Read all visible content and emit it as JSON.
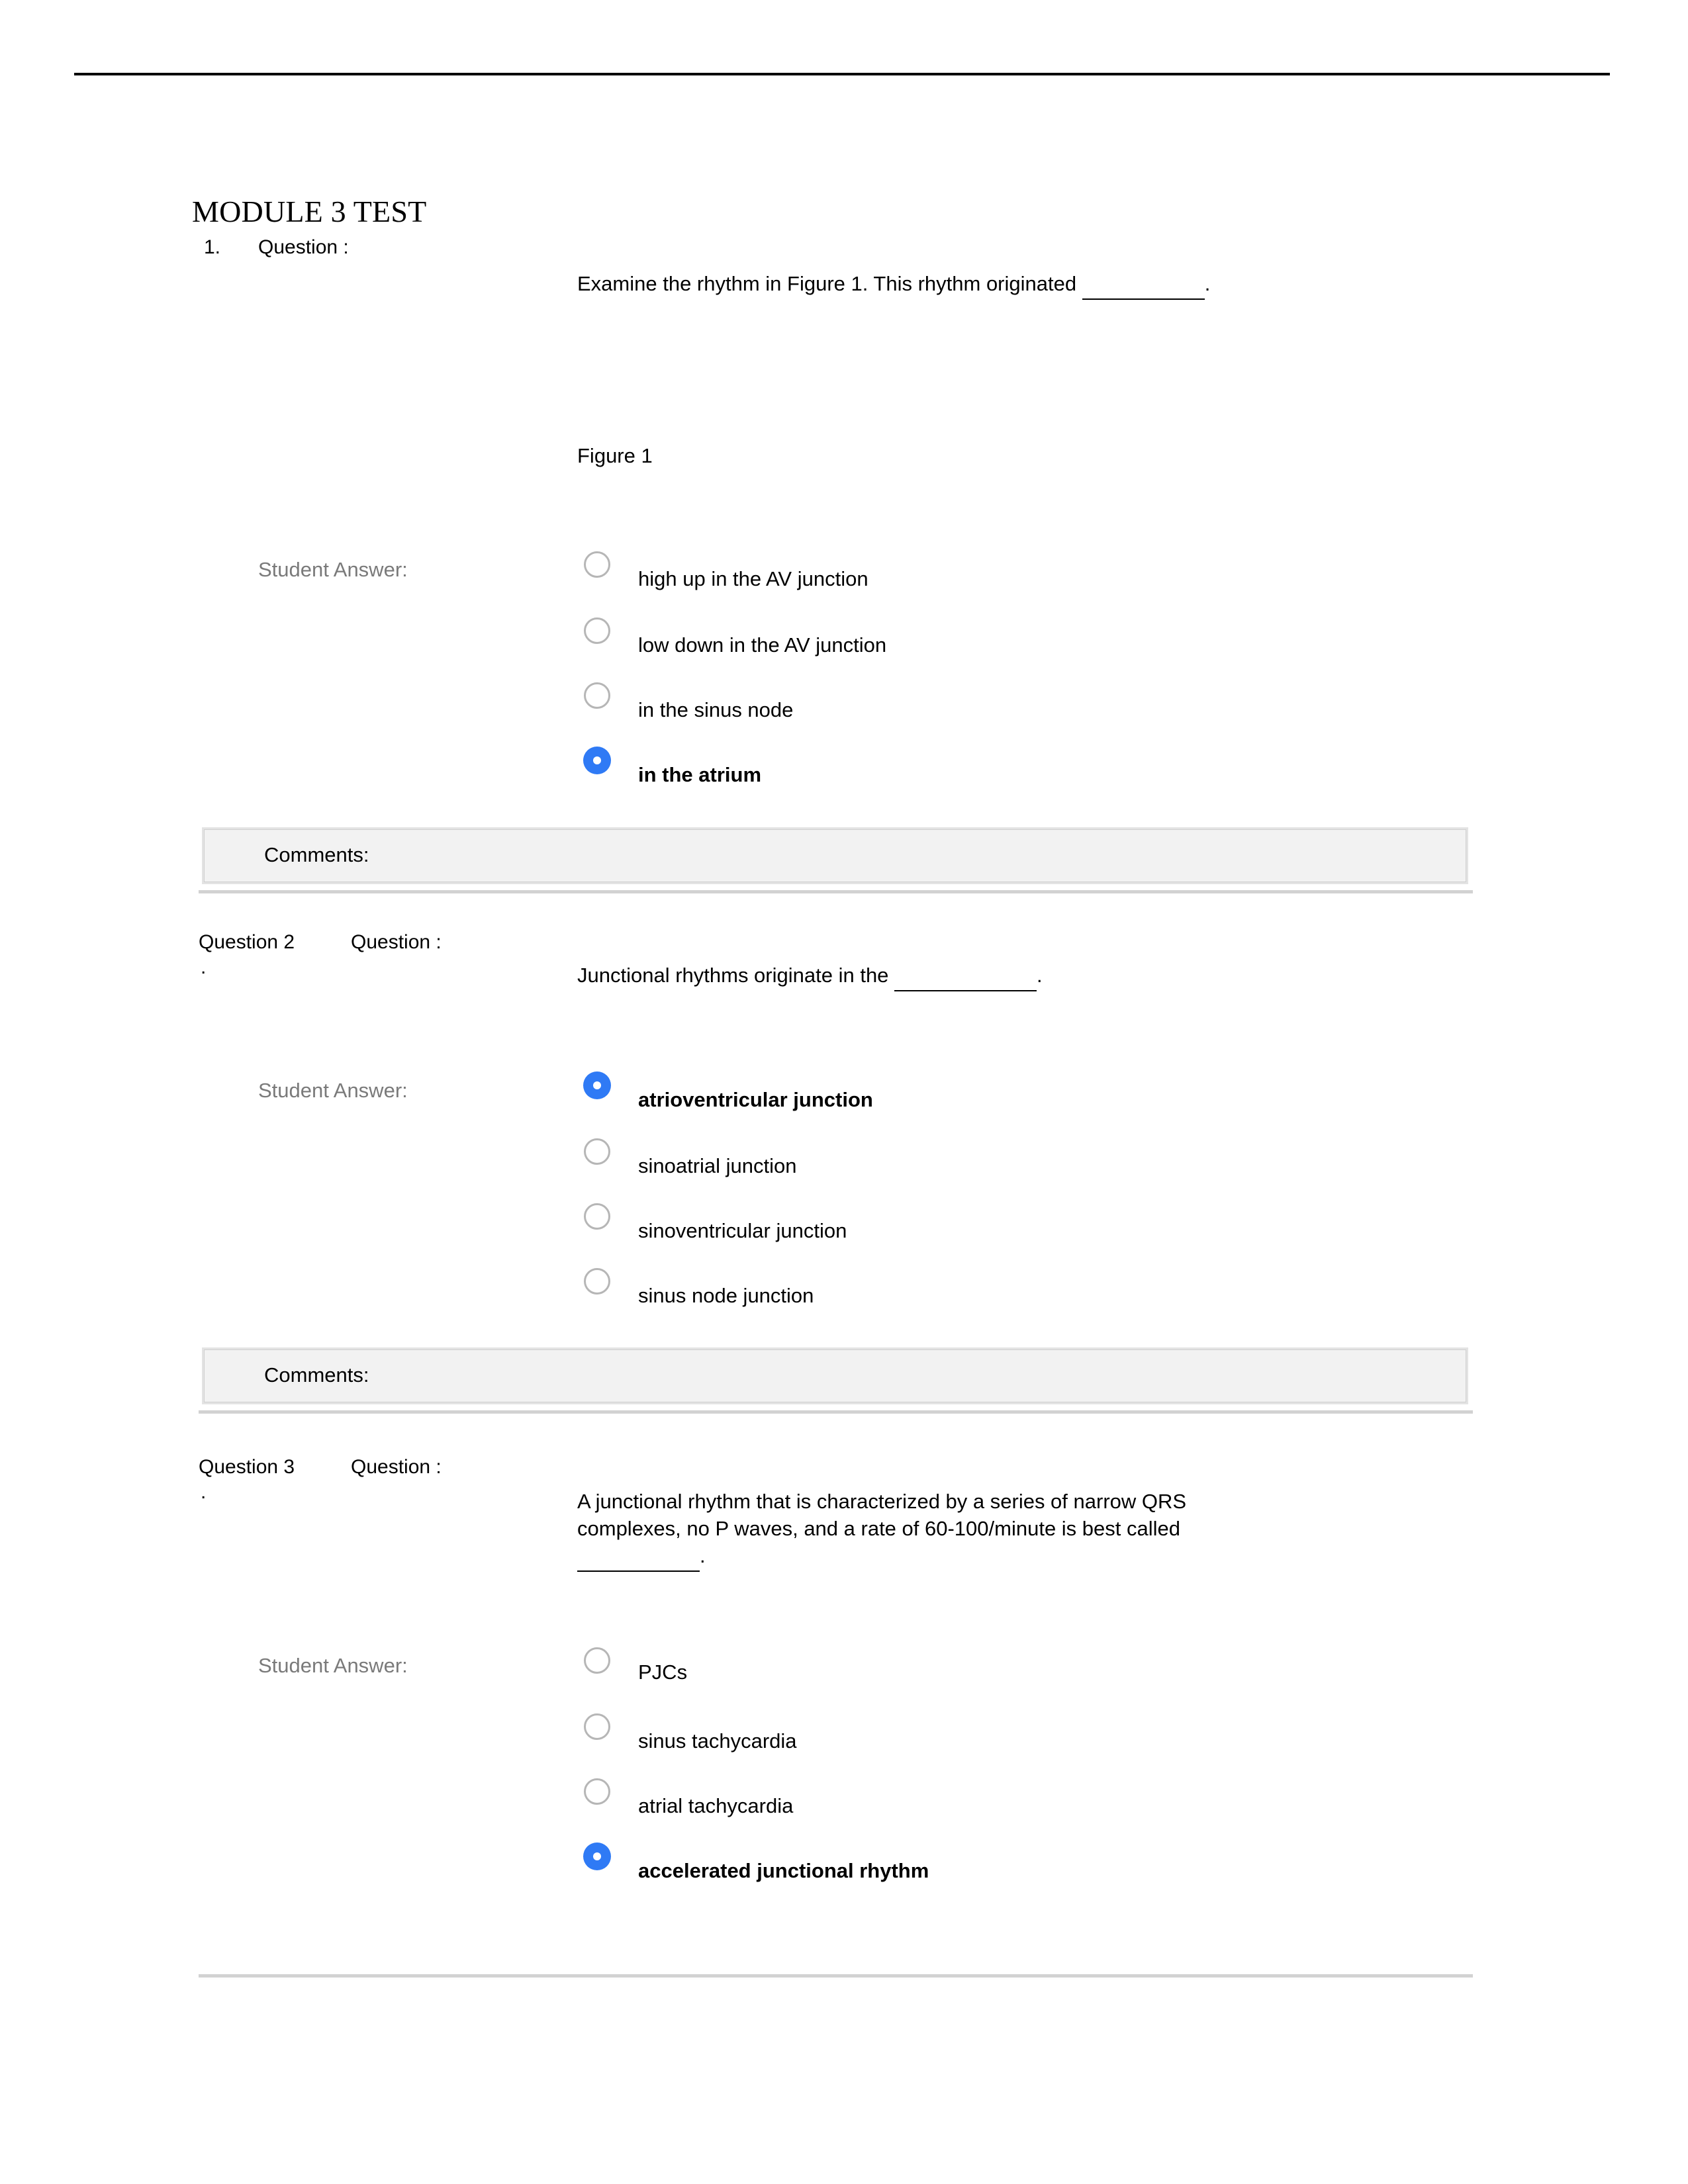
{
  "document": {
    "title": "MODULE 3 TEST"
  },
  "labels": {
    "question_word": "Question :",
    "student_answer": "Student Answer:",
    "comments": "Comments:",
    "figure_caption": "Figure 1"
  },
  "questions": [
    {
      "number_label": "1.",
      "question_word": "Question :",
      "prompt_prefix": "Examine the rhythm in Figure 1. This rhythm originated ",
      "prompt_suffix": ".",
      "figure_caption": "Figure 1",
      "student_answer_label": "Student Answer:",
      "options": [
        {
          "label": "high up in the AV junction",
          "selected": false
        },
        {
          "label": "low down in the AV junction",
          "selected": false
        },
        {
          "label": "in the sinus node",
          "selected": false
        },
        {
          "label": "in the atrium",
          "selected": true
        }
      ],
      "comments_label": "Comments:",
      "comments_value": ""
    },
    {
      "number_label": "Question 2",
      "dot": ".",
      "question_word": "Question :",
      "prompt_prefix": "Junctional rhythms originate in the ",
      "prompt_suffix": ".",
      "student_answer_label": "Student Answer:",
      "options": [
        {
          "label": "atrioventricular junction",
          "selected": true
        },
        {
          "label": "sinoatrial junction",
          "selected": false
        },
        {
          "label": "sinoventricular junction",
          "selected": false
        },
        {
          "label": "sinus node junction",
          "selected": false
        }
      ],
      "comments_label": "Comments:",
      "comments_value": ""
    },
    {
      "number_label": "Question 3",
      "dot": ".",
      "question_word": "Question :",
      "prompt_line1": "A junctional rhythm that is characterized by a series of narrow QRS",
      "prompt_line2": "complexes, no P waves, and a rate of 60-100/minute is best called",
      "prompt_suffix": ".",
      "student_answer_label": "Student Answer:",
      "options": [
        {
          "label": "PJCs",
          "selected": false
        },
        {
          "label": "sinus tachycardia",
          "selected": false
        },
        {
          "label": "atrial tachycardia",
          "selected": false
        },
        {
          "label": "accelerated junctional rhythm",
          "selected": true
        }
      ]
    }
  ],
  "colors": {
    "selected_radio": "#2f7af5",
    "unselected_radio_border": "#b6b6b6",
    "muted_label": "#7a7a7a",
    "comments_bg": "#f2f2f2",
    "separator": "#d2d2d2",
    "header_rule": "#000000"
  }
}
